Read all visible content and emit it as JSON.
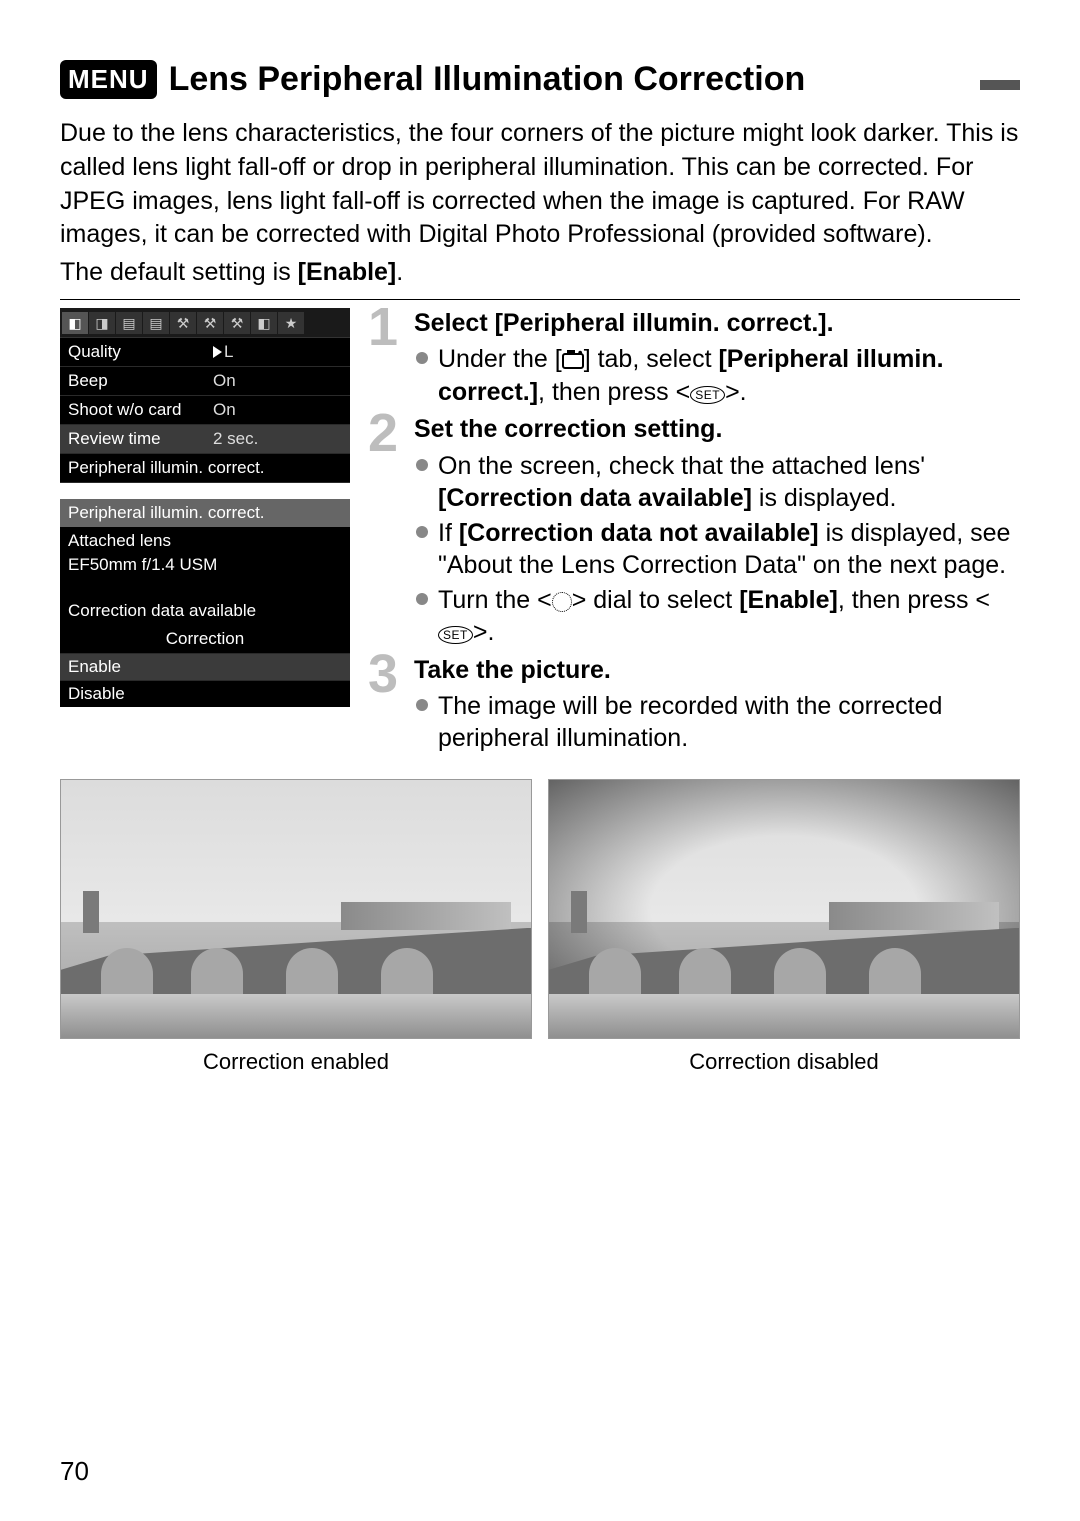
{
  "header": {
    "menu_badge": "MENU",
    "title": "Lens Peripheral Illumination Correction"
  },
  "intro": "Due to the lens characteristics, the four corners of the picture might look darker. This is called lens light fall-off or drop in peripheral illumination. This can be corrected. For JPEG images, lens light fall-off is corrected when the image is captured. For RAW images, it can be corrected with Digital Photo Professional (provided software).",
  "default_prefix": "The default setting is ",
  "default_value": "[Enable]",
  "default_suffix": ".",
  "screen1": {
    "rows": [
      {
        "label": "Quality",
        "value": "◣L"
      },
      {
        "label": "Beep",
        "value": "On"
      },
      {
        "label": "Shoot w/o card",
        "value": "On"
      },
      {
        "label": "Review time",
        "value": "2 sec."
      },
      {
        "label": "Peripheral illumin. correct.",
        "value": ""
      }
    ]
  },
  "screen2": {
    "header": "Peripheral illumin. correct.",
    "attached_label": "Attached lens",
    "lens": "EF50mm f/1.4 USM",
    "data_status": "Correction data available",
    "correction_label": "Correction",
    "options": [
      "Enable",
      "Disable"
    ]
  },
  "steps": [
    {
      "num": "1",
      "title": "Select [Peripheral illumin. correct.].",
      "bullets": [
        {
          "pre": "Under the [",
          "icon": "camera",
          "mid": "] tab, select ",
          "bold": "[Peripheral illumin. correct.]",
          "post1": ", then press <",
          "icon2": "set",
          "post2": ">."
        }
      ]
    },
    {
      "num": "2",
      "title": "Set the correction setting.",
      "bullets": [
        {
          "pre": "On the screen, check that the attached lens' ",
          "bold": "[Correction data available]",
          "post1": " is displayed."
        },
        {
          "pre": "If ",
          "bold": "[Correction data not available]",
          "post1": " is displayed, see \"About the Lens Correction Data\" on the next page."
        },
        {
          "pre": "Turn the <",
          "icon": "dial",
          "mid": "> dial to select ",
          "bold": "[Enable]",
          "post1": ", then press <",
          "icon2": "set",
          "post2": ">."
        }
      ]
    },
    {
      "num": "3",
      "title": "Take the picture.",
      "bullets": [
        {
          "pre": "The image will be recorded with the corrected peripheral illumination."
        }
      ]
    }
  ],
  "captions": {
    "enabled": "Correction enabled",
    "disabled": "Correction disabled"
  },
  "page_number": "70"
}
